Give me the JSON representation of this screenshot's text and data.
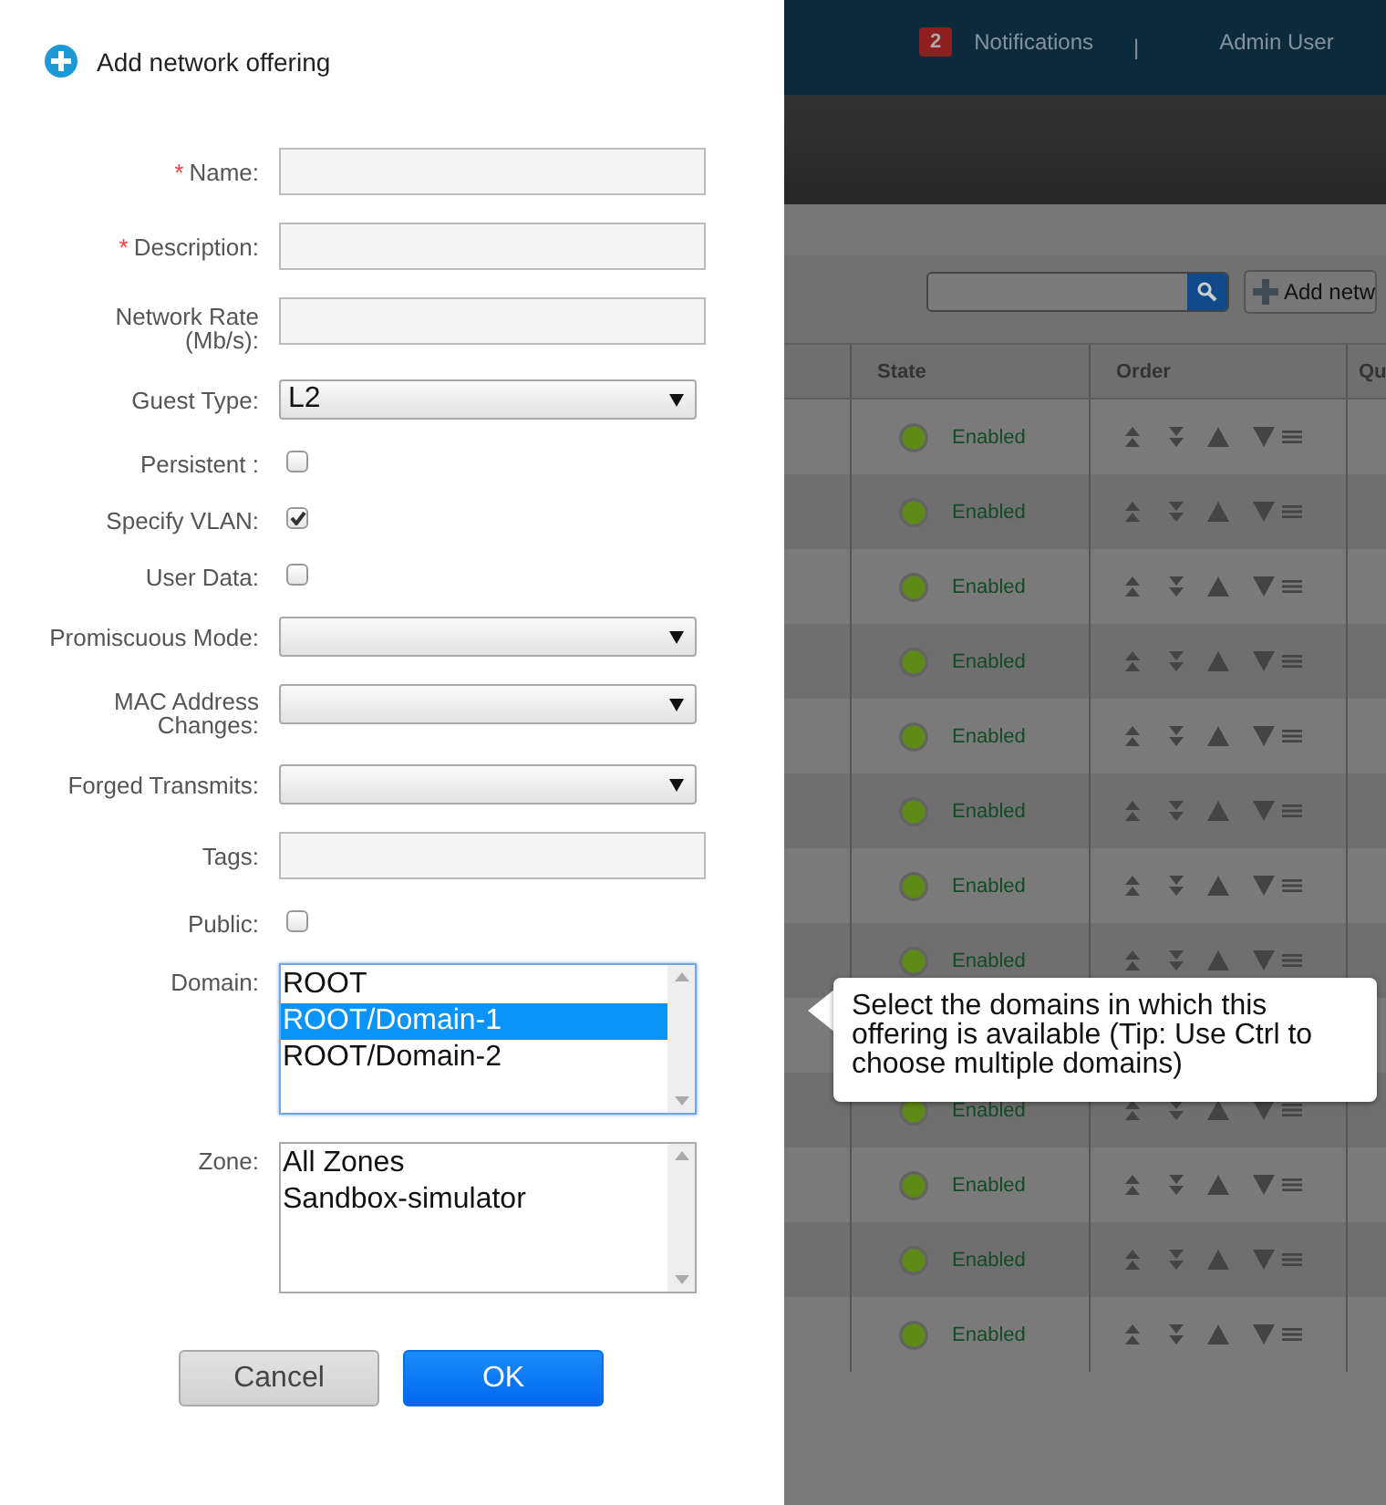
{
  "header": {
    "notification_count": "2",
    "notifications": "Notifications",
    "separator": "|",
    "user": "Admin User"
  },
  "toolbar": {
    "add_button": "Add netw"
  },
  "table": {
    "columns": [
      "State",
      "Order",
      "Qu"
    ],
    "rows": [
      {
        "state": "Enabled"
      },
      {
        "state": "Enabled"
      },
      {
        "state": "Enabled"
      },
      {
        "state": "Enabled"
      },
      {
        "state": "Enabled"
      },
      {
        "state": "Enabled"
      },
      {
        "state": "Enabled"
      },
      {
        "state": "Enabled"
      },
      {
        "state": "Enabled"
      },
      {
        "state": "Enabled"
      },
      {
        "state": "Enabled"
      },
      {
        "state": "Enabled"
      }
    ]
  },
  "dialog": {
    "title": "Add network offering",
    "fields": [
      {
        "kind": "text",
        "label": "Name:",
        "marker": "*"
      },
      {
        "kind": "text",
        "label": "Description:",
        "marker": "*"
      },
      {
        "kind": "text",
        "label": "Network Rate (Mb/s):"
      },
      {
        "kind": "select",
        "label": "Guest Type:",
        "value": "L2"
      },
      {
        "kind": "checkbox",
        "label": "Persistent :",
        "checked": false
      },
      {
        "kind": "checkbox",
        "label": "Specify VLAN:",
        "checked": true
      },
      {
        "kind": "checkbox",
        "label": "User Data:",
        "checked": false
      },
      {
        "kind": "select",
        "label": "Promiscuous Mode:"
      },
      {
        "kind": "select",
        "label": "MAC Address Changes:"
      },
      {
        "kind": "select",
        "label": "Forged Transmits:"
      },
      {
        "kind": "text",
        "label": "Tags:"
      },
      {
        "kind": "checkbox",
        "label": "Public:",
        "checked": false
      },
      {
        "kind": "listbox",
        "label": "Domain:",
        "focused": true,
        "options": [
          {
            "label": "ROOT",
            "selected": false
          },
          {
            "label": "ROOT/Domain-1",
            "selected": true
          },
          {
            "label": "ROOT/Domain-2",
            "selected": false
          }
        ]
      },
      {
        "kind": "listbox",
        "label": "Zone:",
        "focused": false,
        "options": [
          {
            "label": "All Zones",
            "selected": false
          },
          {
            "label": "Sandbox-simulator",
            "selected": false
          }
        ]
      }
    ],
    "buttons": [
      {
        "label": "Cancel",
        "kind": "secondary"
      },
      {
        "label": "OK",
        "kind": "primary"
      }
    ]
  },
  "tooltip": {
    "text": "Select the domains in which this offering is available (Tip: Use Ctrl to choose multiple domains)"
  }
}
